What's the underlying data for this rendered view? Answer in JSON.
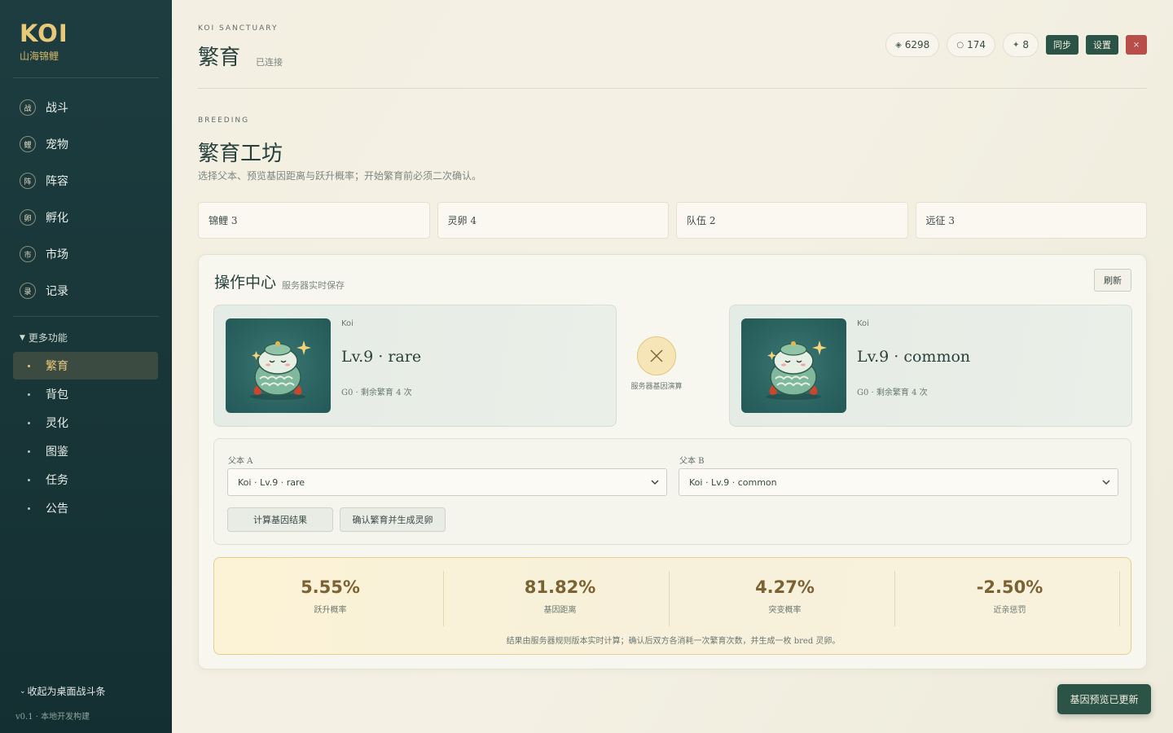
{
  "sidebar": {
    "brand": "KOI",
    "brand_sub": "山海锦鲤",
    "nav": [
      {
        "badge": "战",
        "label": "战斗"
      },
      {
        "badge": "鲤",
        "label": "宠物"
      },
      {
        "badge": "阵",
        "label": "阵容"
      },
      {
        "badge": "卵",
        "label": "孵化"
      },
      {
        "badge": "市",
        "label": "市场"
      },
      {
        "badge": "录",
        "label": "记录"
      }
    ],
    "more_label": "更多功能",
    "sub_items": [
      {
        "label": "繁育",
        "active": true
      },
      {
        "label": "背包"
      },
      {
        "label": "灵化"
      },
      {
        "label": "图鉴"
      },
      {
        "label": "任务"
      },
      {
        "label": "公告"
      }
    ],
    "collapse_label": "收起为桌面战斗条",
    "version": "v0.1 · 本地开发构建"
  },
  "header": {
    "kicker": "KOI SANCTUARY",
    "title": "繁育",
    "status": "已连接",
    "currency": [
      {
        "icon": "diamond-icon",
        "glyph": "◈",
        "value": "6298"
      },
      {
        "icon": "ring-icon",
        "glyph": "○",
        "value": "174"
      },
      {
        "icon": "star-icon",
        "glyph": "✦",
        "value": "8"
      }
    ],
    "sync_label": "同步",
    "settings_label": "设置",
    "close_label": "×"
  },
  "section": {
    "kicker": "BREEDING",
    "title": "繁育工坊",
    "desc": "选择父本、预览基因距离与跃升概率；开始繁育前必须二次确认。",
    "stats": [
      "锦鲤 3",
      "灵卵 4",
      "队伍 2",
      "远征 3"
    ]
  },
  "panel": {
    "title": "操作中心",
    "subtitle": "服务器实时保存",
    "refresh_label": "刷新",
    "parent_a": {
      "species": "Koi",
      "title": "Lv.9 · rare",
      "meta": "G0 · 剩余繁育 4 次"
    },
    "parent_b": {
      "species": "Koi",
      "title": "Lv.9 · common",
      "meta": "G0 · 剩余繁育 4 次"
    },
    "cross_caption": "服务器基因演算",
    "form": {
      "label_a": "父本 A",
      "select_a": "Koi · Lv.9 · rare",
      "label_b": "父本 B",
      "select_b": "Koi · Lv.9 · common",
      "calc_button": "计算基因结果",
      "confirm_button": "确认繁育并生成灵卵"
    },
    "results": [
      {
        "value": "5.55%",
        "label": "跃升概率"
      },
      {
        "value": "81.82%",
        "label": "基因距离"
      },
      {
        "value": "4.27%",
        "label": "突变概率"
      },
      {
        "value": "-2.50%",
        "label": "近亲惩罚"
      }
    ],
    "result_note": "结果由服务器规则版本实时计算；确认后双方各消耗一次繁育次数，并生成一枚 bred 灵卵。"
  },
  "toast": "基因预览已更新",
  "colors": {
    "sidebar": "#1d3d40",
    "accent_gold": "#e6c87a",
    "primary": "#2b5346",
    "danger": "#b84d4a"
  }
}
